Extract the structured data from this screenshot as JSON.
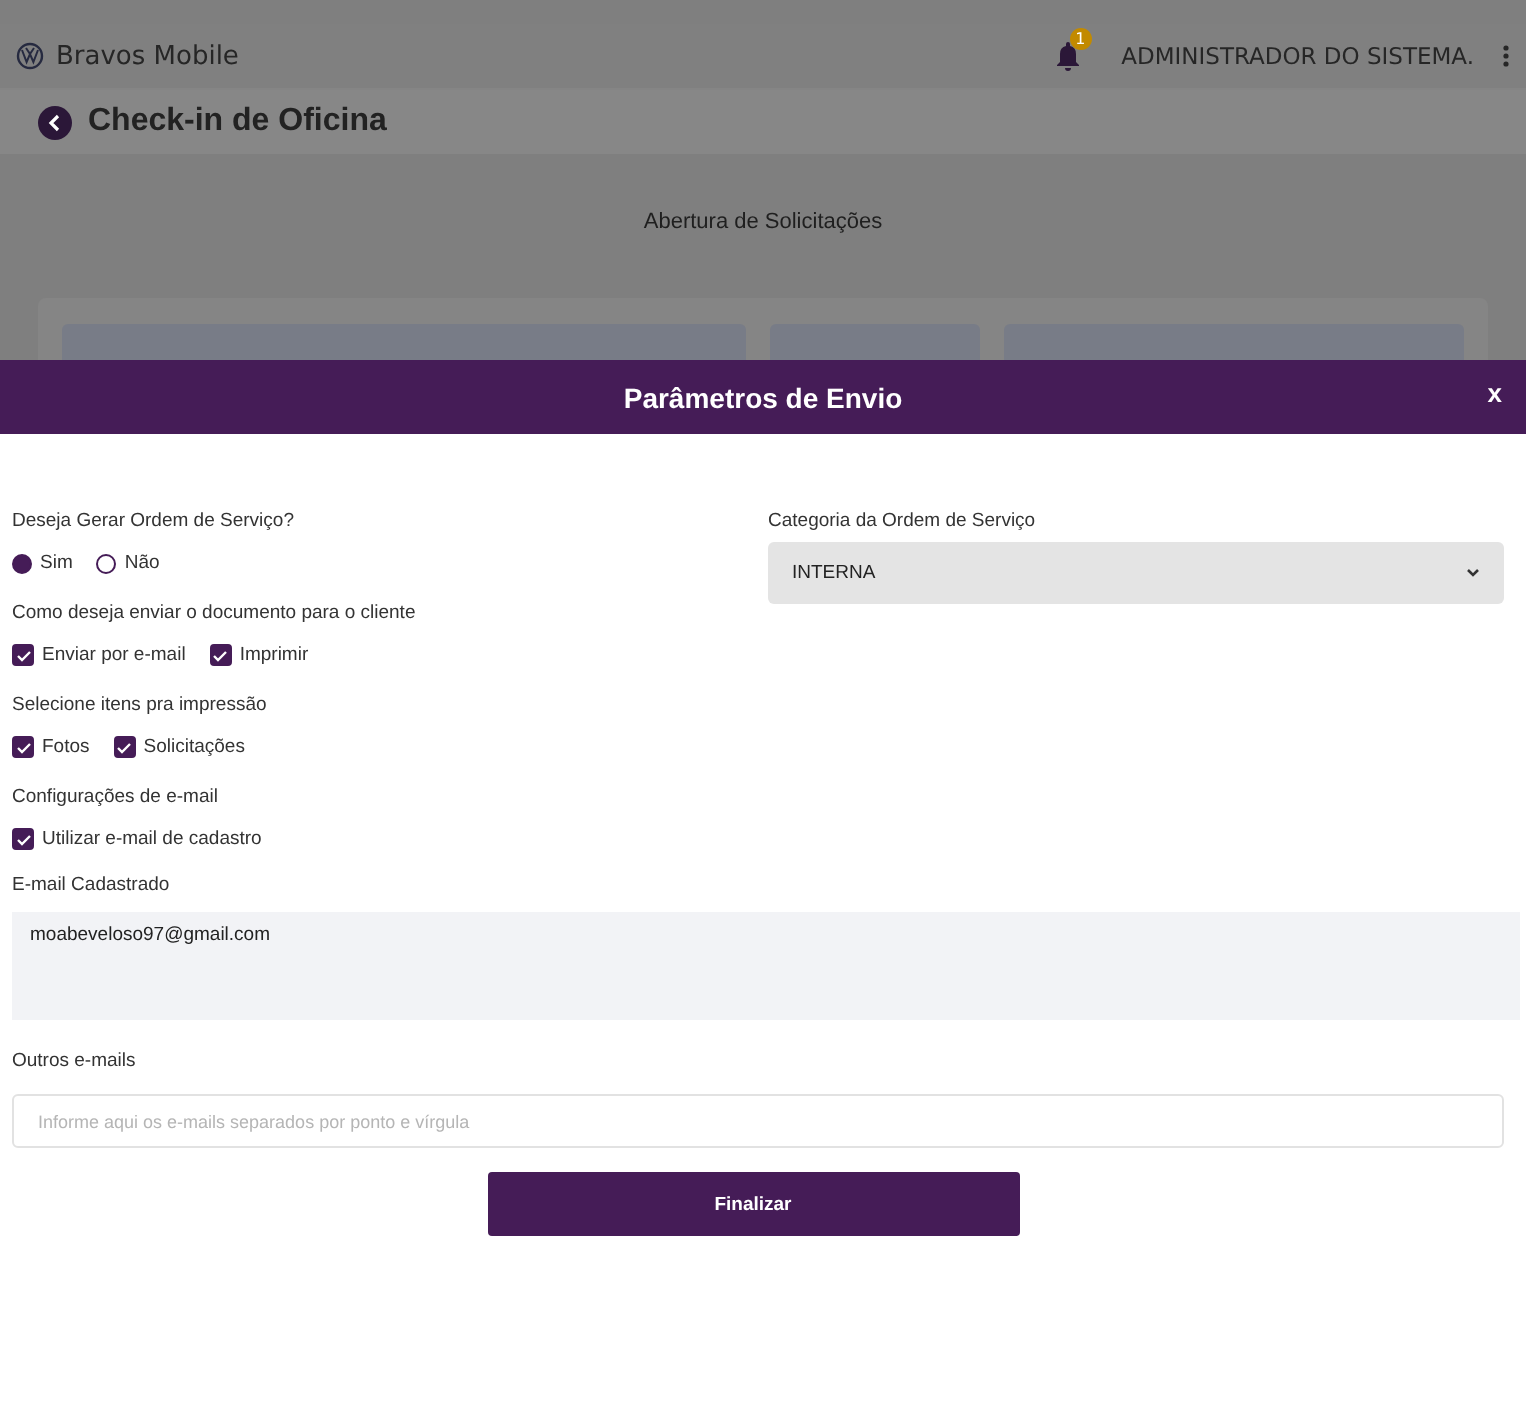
{
  "app_bar": {
    "brand": "Bravos Mobile",
    "notification_count": "1",
    "user": "ADMINISTRADOR DO SISTEMA."
  },
  "page": {
    "title": "Check-in de Oficina",
    "section_title": "Abertura de Solicitações"
  },
  "dialog": {
    "title": "Parâmetros de Envio",
    "close": "x",
    "service_order": {
      "label": "Deseja Gerar Ordem de Serviço?",
      "options": [
        {
          "label": "Sim",
          "selected": true
        },
        {
          "label": "Não",
          "selected": false
        }
      ]
    },
    "category": {
      "label": "Categoria da Ordem de Serviço",
      "value": "INTERNA"
    },
    "groups": [
      {
        "label": "Como deseja enviar o documento para o cliente",
        "options": [
          {
            "label": "Enviar por e-mail",
            "checked": true
          },
          {
            "label": "Imprimir",
            "checked": true
          }
        ]
      },
      {
        "label": "Selecione itens pra impressão",
        "options": [
          {
            "label": "Fotos",
            "checked": true
          },
          {
            "label": "Solicitações",
            "checked": true
          }
        ]
      },
      {
        "label": "Configurações de e-mail",
        "options": [
          {
            "label": "Utilizar e-mail de cadastro",
            "checked": true
          }
        ]
      }
    ],
    "registered_email": {
      "label": "E-mail Cadastrado",
      "value": "moabeveloso97@gmail.com"
    },
    "other_emails": {
      "label": "Outros e-mails",
      "placeholder": "Informe aqui os e-mails separados por ponto e vírgula"
    },
    "submit": "Finalizar"
  }
}
